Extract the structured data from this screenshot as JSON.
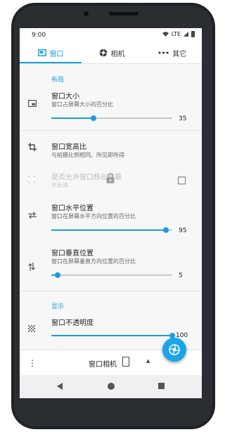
{
  "status": {
    "time": "9:00",
    "network": "LTE"
  },
  "tabs": [
    {
      "label": "窗口",
      "icon": "window-icon",
      "active": true
    },
    {
      "label": "相机",
      "icon": "aperture-icon",
      "active": false
    },
    {
      "label": "其它",
      "icon": "more-horizontal-icon",
      "active": false
    }
  ],
  "sections": {
    "layout": "布局",
    "display": "显示"
  },
  "settings": {
    "window_size": {
      "title": "窗口大小",
      "subtitle": "窗口占屏幕大小的百分比",
      "value": 35,
      "min": 0,
      "max": 100
    },
    "aspect_ratio": {
      "title": "窗口宽高比",
      "subtitle": "与拍摄比例相同。所见即所得"
    },
    "allow_move_out": {
      "title": "是否允许窗口移出屏幕",
      "subtitle": "不允许",
      "checked": false,
      "enabled": false
    },
    "horizontal_position": {
      "title": "窗口水平位置",
      "subtitle": "窗口在屏幕水平方向位置的百分比",
      "value": 95,
      "min": 0,
      "max": 100
    },
    "vertical_position": {
      "title": "窗口垂直位置",
      "subtitle": "窗口在屏幕垂直方向位置的百分比",
      "value": 5,
      "min": 0,
      "max": 100
    },
    "opacity": {
      "title": "窗口不透明度",
      "value": 100,
      "min": 0,
      "max": 100
    }
  },
  "bottom_bar": {
    "title": "窗口相机"
  },
  "colors": {
    "accent": "#1a9de0",
    "fab": "#1aa5e8"
  }
}
